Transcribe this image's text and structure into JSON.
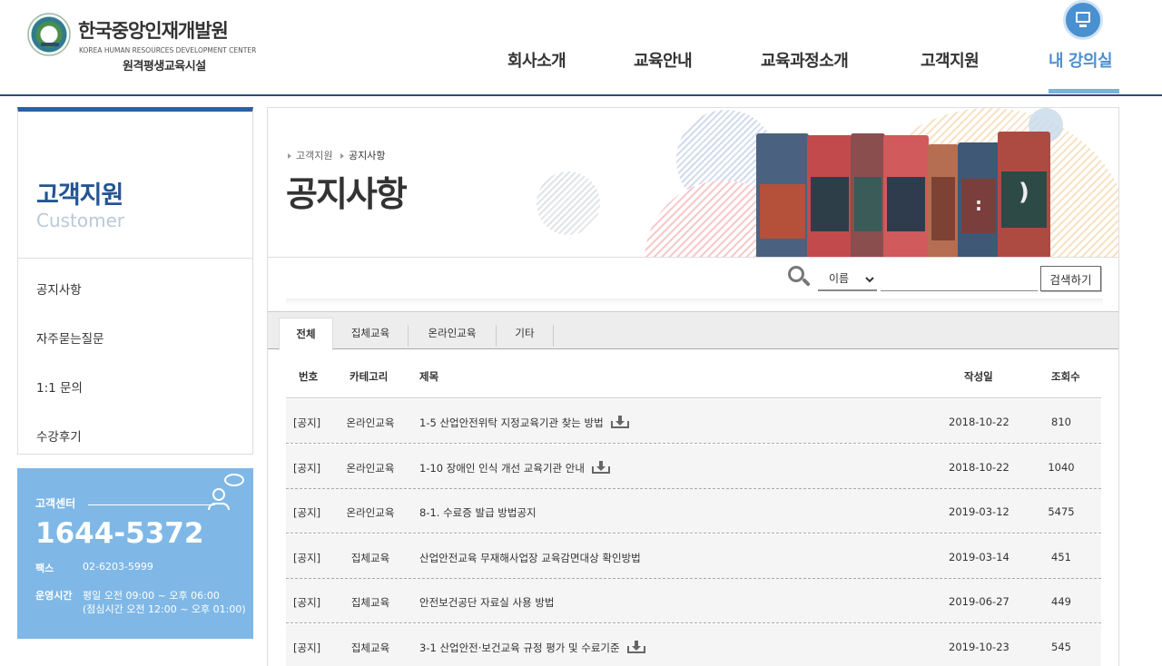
{
  "header": {
    "logo_title": "한국중앙인재개발원",
    "logo_subtitle": "KOREA HUMAN RESOURCES DEVELOPMENT CENTER",
    "logo_tagline": "원격평생교육시설",
    "nav": [
      "회사소개",
      "교육안내",
      "교육과정소개",
      "고객지원",
      "내 강의실"
    ],
    "active_nav": "내 강의실",
    "accent_color": "#4d8fcf"
  },
  "sidebar": {
    "title": "고객지원",
    "subtitle": "Customer",
    "items": [
      "공지사항",
      "자주묻는질문",
      "1:1 문의",
      "수강후기"
    ]
  },
  "customer_center": {
    "label": "고객센터",
    "phone": "1644-5372",
    "fax_label": "팩스",
    "fax": "02-6203-5999",
    "hours_label": "운영시간",
    "hours": "평일 오전 09:00 ~ 오후 06:00",
    "lunch": "(점심시간 오전 12:00 ~ 오후 01:00)"
  },
  "banner": {
    "breadcrumb": [
      "고객지원",
      "공지사항"
    ],
    "title": "공지사항",
    "book_labels": [
      ":",
      ")"
    ]
  },
  "search": {
    "select_value": "이름",
    "input_value": "",
    "button_label": "검색하기"
  },
  "tabs": [
    "전체",
    "집체교육",
    "온라인교육",
    "기타"
  ],
  "active_tab": "전체",
  "table": {
    "headers": [
      "번호",
      "카테고리",
      "제목",
      "작성일",
      "조회수"
    ],
    "rows": [
      {
        "no": "[공지]",
        "category": "온라인교육",
        "title": "1-5 산업안전위탁 지정교육기관 찾는 방법",
        "attachment": true,
        "date": "2018-10-22",
        "views": "810"
      },
      {
        "no": "[공지]",
        "category": "온라인교육",
        "title": "1-10 장애인 인식 개선 교육기관 안내",
        "attachment": true,
        "date": "2018-10-22",
        "views": "1040"
      },
      {
        "no": "[공지]",
        "category": "온라인교육",
        "title": "8-1. 수료증 발급 방법공지",
        "attachment": false,
        "date": "2019-03-12",
        "views": "5475"
      },
      {
        "no": "[공지]",
        "category": "집체교육",
        "title": "산업안전교육 무재해사업장 교육감면대상 확인방법",
        "attachment": false,
        "date": "2019-03-14",
        "views": "451"
      },
      {
        "no": "[공지]",
        "category": "집체교육",
        "title": "안전보건공단 자료실 사용 방법",
        "attachment": false,
        "date": "2019-06-27",
        "views": "449"
      },
      {
        "no": "[공지]",
        "category": "집체교육",
        "title": "3-1 산업안전·보건교육 규정 평가 및 수료기준",
        "attachment": true,
        "date": "2019-10-23",
        "views": "545"
      }
    ]
  }
}
